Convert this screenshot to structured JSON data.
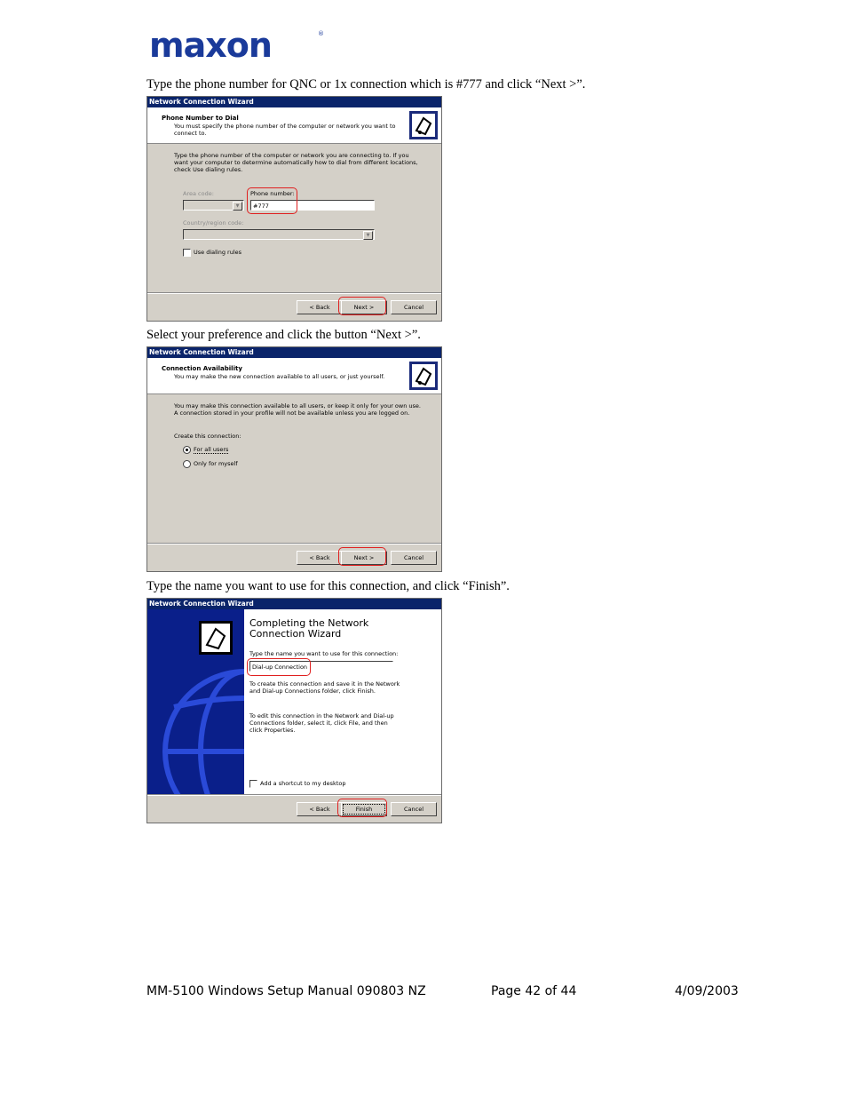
{
  "logo": {
    "text": "maxon",
    "registered": "®"
  },
  "steps": [
    {
      "instruction": "Type the phone number for QNC or 1x connection which is #777 and click “Next >”."
    },
    {
      "instruction": "Select your preference and click the button “Next >”."
    },
    {
      "instruction": "Type the name you want to use for this connection, and click “Finish”."
    }
  ],
  "dialog1": {
    "title": "Network Connection Wizard",
    "header_title": "Phone Number to Dial",
    "header_sub": "You must specify the phone number of the computer or network you want to connect to.",
    "body": "Type the phone number of the computer or network you are connecting to. If you want your computer to determine automatically how to dial from different locations, check Use dialing rules.",
    "area_code_label": "Area code:",
    "phone_label": "Phone number:",
    "phone_value": "#777",
    "country_label": "Country/region code:",
    "use_dialing_rules": "Use dialing rules",
    "back": "< Back",
    "next": "Next >",
    "cancel": "Cancel"
  },
  "dialog2": {
    "title": "Network Connection Wizard",
    "header_title": "Connection Availability",
    "header_sub": "You may make the new connection available to all users, or just yourself.",
    "body": "You may make this connection available to all users, or keep it only for your own use. A connection stored in your profile will not be available unless you are logged on.",
    "create_label": "Create this connection:",
    "opt_all": "For all users",
    "opt_me": "Only for myself",
    "back": "< Back",
    "next": "Next >",
    "cancel": "Cancel"
  },
  "dialog3": {
    "title": "Network Connection Wizard",
    "heading": "Completing the Network Connection Wizard",
    "name_label": "Type the name you want to use for this connection:",
    "name_value": "Dial-up Connection",
    "para1": "To create this connection and save it in the Network and Dial-up Connections folder, click Finish.",
    "para2": "To edit this connection in the Network and Dial-up Connections folder, select it, click File, and then click Properties.",
    "shortcut": "Add a shortcut to my desktop",
    "back": "< Back",
    "finish": "Finish",
    "cancel": "Cancel"
  },
  "footer": {
    "left": "MM-5100 Windows Setup Manual 090803 NZ",
    "center": "Page 42 of 44",
    "right": "4/09/2003"
  },
  "colors": {
    "highlight": "#e02020",
    "titlebar": "#0a246a",
    "logo": "#1a3a9a"
  }
}
